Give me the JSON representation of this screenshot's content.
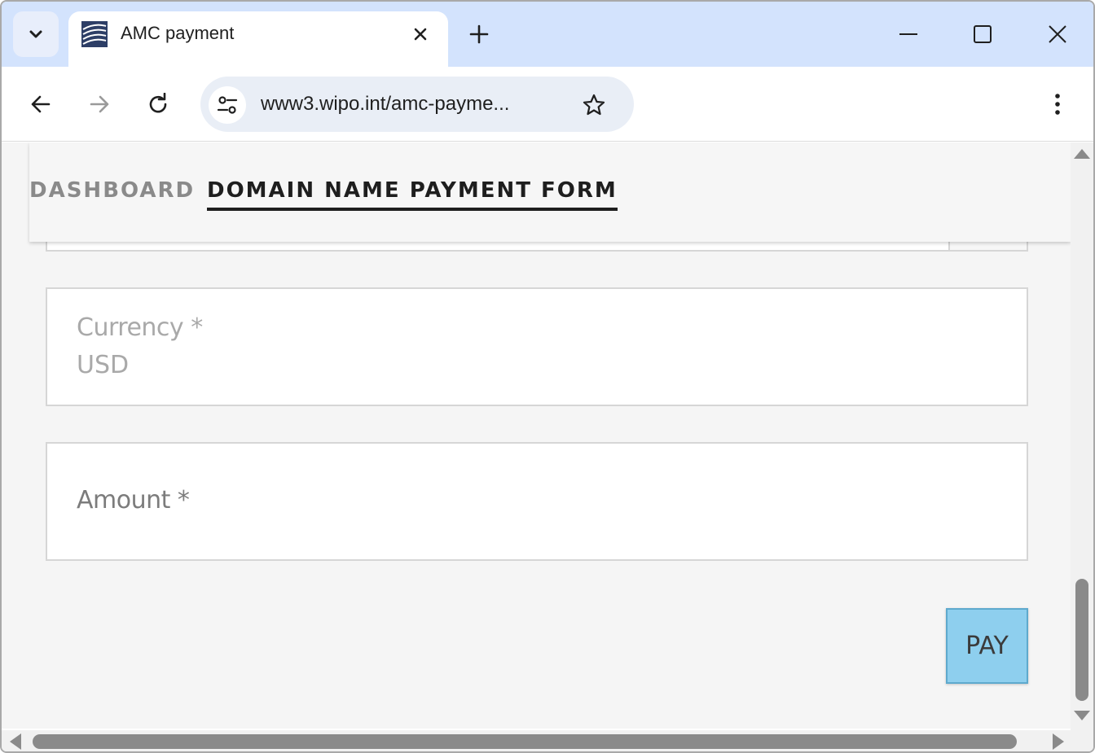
{
  "browser": {
    "tab": {
      "title": "AMC payment",
      "favicon": "wipo-globe-icon"
    },
    "address_bar": {
      "url": "www3.wipo.int/amc-payme..."
    },
    "icons": {
      "tab_search": "chevron-down-icon",
      "close_tab": "close-icon",
      "new_tab": "plus-icon",
      "minimize": "minimize-icon",
      "maximize": "maximize-icon",
      "close_window": "close-icon",
      "back": "back-arrow-icon",
      "forward": "forward-arrow-icon",
      "reload": "reload-icon",
      "site_info": "tune-icon",
      "bookmark": "star-icon",
      "menu": "kebab-menu-icon"
    }
  },
  "page": {
    "nav": {
      "items": [
        {
          "label": "DASHBOARD",
          "active": false
        },
        {
          "label": "DOMAIN NAME PAYMENT FORM",
          "active": true
        }
      ]
    },
    "form": {
      "currency": {
        "label": "Currency *",
        "value": "USD"
      },
      "amount": {
        "label": "Amount *",
        "value": ""
      },
      "pay_button": {
        "label": "PAY"
      }
    }
  },
  "colors": {
    "tabstrip_bg": "#d3e3fd",
    "page_bg": "#f5f5f5",
    "pay_button_bg": "#8ecfee",
    "nav_active": "#1e1e1e",
    "nav_inactive": "#8a8a8a"
  }
}
